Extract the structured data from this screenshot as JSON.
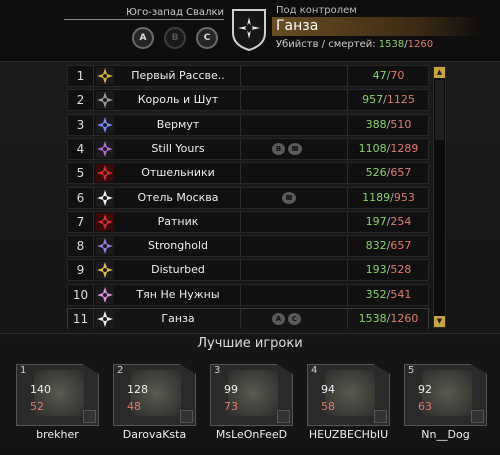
{
  "header": {
    "zone_name": "Юго-запад Свалки",
    "points": [
      "A",
      "B",
      "C"
    ],
    "control_label": "Под контролем",
    "controller": "Ганза",
    "stats_label": "Убийств / смертей:",
    "kills": "1538",
    "deaths": "1260",
    "slash": "/"
  },
  "clans": [
    {
      "rank": "1",
      "name": "Первый Рассве..",
      "kills": "47",
      "deaths": "70",
      "icon": "gold-crown-emblem",
      "badges": []
    },
    {
      "rank": "2",
      "name": "Король и Шут",
      "kills": "957",
      "deaths": "1125",
      "icon": "crossed-axes-emblem",
      "badges": []
    },
    {
      "rank": "3",
      "name": "Вермут",
      "kills": "388",
      "deaths": "510",
      "icon": "blue-star-emblem",
      "badges": []
    },
    {
      "rank": "4",
      "name": "Still Yours",
      "kills": "1108",
      "deaths": "1289",
      "icon": "purple-star-emblem",
      "badges": [
        "B",
        "flag"
      ]
    },
    {
      "rank": "5",
      "name": "Отшельники",
      "kills": "526",
      "deaths": "657",
      "icon": "red-biohazard-emblem",
      "badges": []
    },
    {
      "rank": "6",
      "name": "Отель Москва",
      "kills": "1189",
      "deaths": "953",
      "icon": "white-star-emblem",
      "badges": [
        "flag"
      ]
    },
    {
      "rank": "7",
      "name": "Ратник",
      "kills": "197",
      "deaths": "254",
      "icon": "red-chevron-emblem",
      "badges": []
    },
    {
      "rank": "8",
      "name": "Stronghold",
      "kills": "832",
      "deaths": "657",
      "icon": "purple-skull-emblem",
      "badges": []
    },
    {
      "rank": "9",
      "name": "Disturbed",
      "kills": "193",
      "deaths": "528",
      "icon": "yellow-skull-emblem",
      "badges": []
    },
    {
      "rank": "10",
      "name": "Тян Не Нужны",
      "kills": "352",
      "deaths": "541",
      "icon": "pink-skull-emblem",
      "badges": []
    },
    {
      "rank": "11",
      "name": "Ганза",
      "kills": "1538",
      "deaths": "1260",
      "icon": "white-star-emblem",
      "badges": [
        "A",
        "C"
      ]
    }
  ],
  "best_players_title": "Лучшие игроки",
  "players": [
    {
      "rank": "1",
      "kills": "140",
      "deaths": "52",
      "name": "brekher"
    },
    {
      "rank": "2",
      "kills": "128",
      "deaths": "48",
      "name": "DarovaKsta"
    },
    {
      "rank": "3",
      "kills": "99",
      "deaths": "73",
      "name": "MsLeOnFeeD"
    },
    {
      "rank": "4",
      "kills": "94",
      "deaths": "58",
      "name": "HEUZBECHbIU"
    },
    {
      "rank": "5",
      "kills": "92",
      "deaths": "63",
      "name": "Nn__Dog"
    }
  ],
  "colors": {
    "kills": "#8ad06b",
    "deaths": "#e07a70",
    "accent": "#c8a247"
  }
}
